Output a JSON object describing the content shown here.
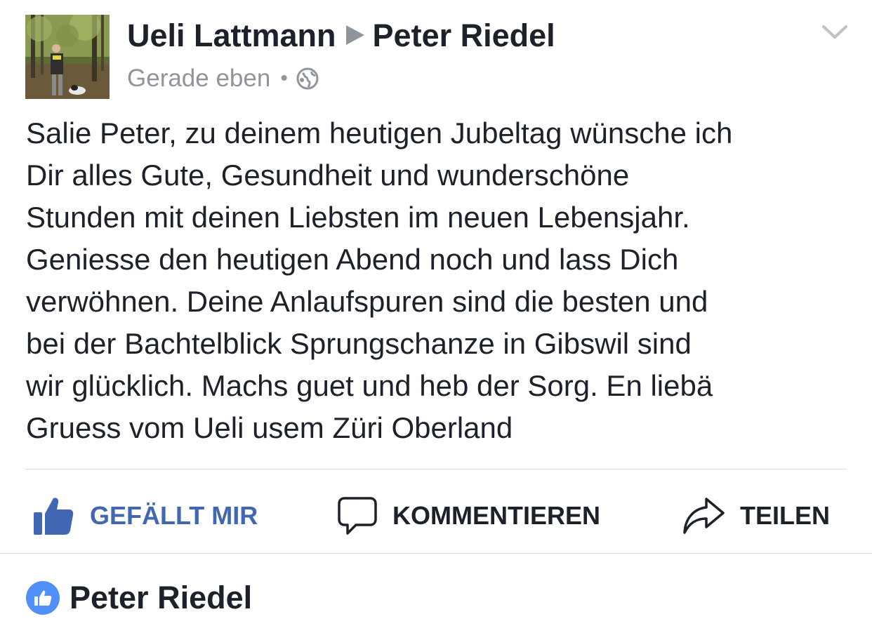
{
  "post": {
    "author": "Ueli Lattmann",
    "recipient": "Peter Riedel",
    "timestamp": "Gerade eben",
    "separator": "•",
    "privacy_icon": "globe-icon",
    "menu_icon": "chevron-down-icon",
    "text": "Salie Peter, zu deinem heutigen Jubeltag wünsche ich\nDir alles Gute,  Gesundheit und wunderschöne\nStunden mit deinen Liebsten im neuen Lebensjahr.\nGeniesse den heutigen Abend noch und lass Dich\nverwöhnen. Deine Anlaufspuren sind die besten und\nbei der Bachtelblick Sprungschanze in Gibswil sind\nwir glücklich. Machs guet und heb der Sorg. En liebä\nGruess vom Ueli usem Züri Oberland"
  },
  "actions": {
    "like_label": "GEFÄLLT MIR",
    "comment_label": "KOMMENTIEREN",
    "share_label": "TEILEN"
  },
  "likes": {
    "name": "Peter Riedel",
    "icon": "thumbs-up-icon"
  },
  "colors": {
    "accent": "#4267b2",
    "like_badge": "#4f8ff7",
    "meta_gray": "#90949c",
    "text": "#1d2129",
    "divider": "#dddfe2"
  }
}
